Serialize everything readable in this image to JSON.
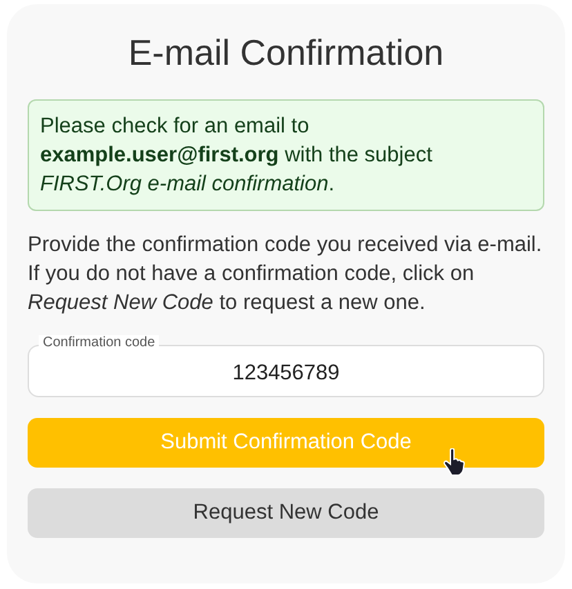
{
  "title": "E-mail Confirmation",
  "notice": "Please check for an email to **example.user@first.org** with the subject *FIRST.Org e-mail confirmation*.",
  "instructions": "Provide the confirmation code you received via e-mail. If you do not have a confirmation code, click on *Request New Code* to request a new one.",
  "code_field": {
    "label": "Confirmation code",
    "value": "123456789"
  },
  "buttons": [
    {
      "label": "Submit Confirmation Code",
      "kind": "primary",
      "hovered": true
    },
    {
      "label": "Request New Code",
      "kind": "secondary",
      "hovered": false
    }
  ]
}
